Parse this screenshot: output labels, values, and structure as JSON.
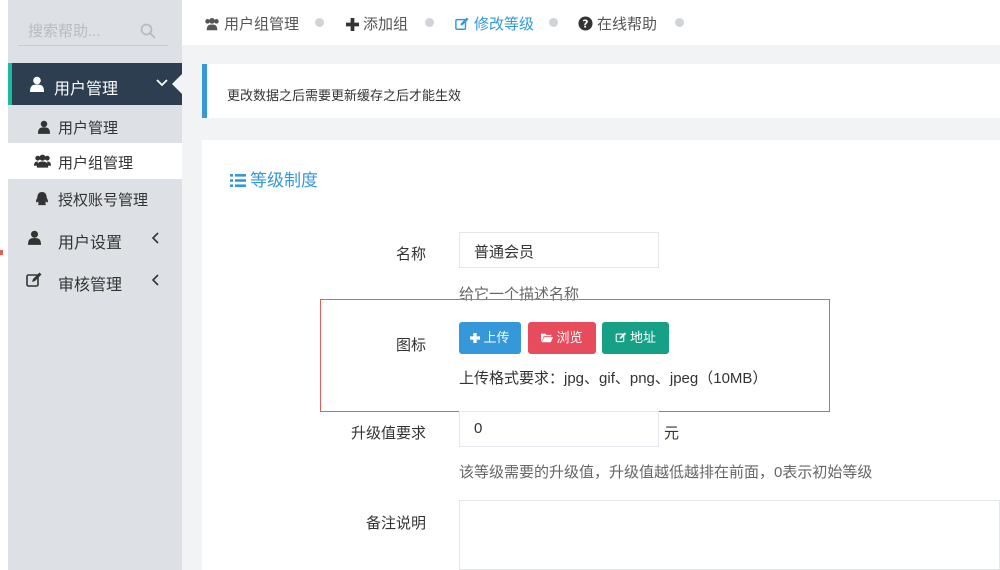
{
  "sidebar": {
    "search_placeholder": "搜索帮助...",
    "menu_user_mgmt": "用户管理",
    "sub_user_mgmt": "用户管理",
    "sub_user_group": "用户组管理",
    "sub_auth_account": "授权账号管理",
    "menu_user_settings": "用户设置",
    "menu_review": "审核管理"
  },
  "topbar": {
    "group_mgmt": "用户组管理",
    "add_group": "添加组",
    "edit_level": "修改等级",
    "online_help": "在线帮助"
  },
  "notice": "更改数据之后需要更新缓存之后才能生效",
  "panel": {
    "title": "等级制度",
    "name_label": "名称",
    "name_value": "普通会员",
    "name_help": "给它一个描述名称",
    "icon_label": "图标",
    "upload": "上传",
    "browse": "浏览",
    "url": "地址",
    "icon_help": "上传格式要求：jpg、gif、png、jpeg（10MB）",
    "upgrade_label": "升级值要求",
    "upgrade_value": "0",
    "upgrade_unit": "元",
    "upgrade_help": "该等级需要的升级值，升级值越低越排在前面，0表示初始等级",
    "remark_label": "备注说明"
  },
  "colors": {
    "accent": "#3498db",
    "danger": "#e74c5c",
    "teal": "#16a085",
    "dark": "#2c3e50"
  }
}
